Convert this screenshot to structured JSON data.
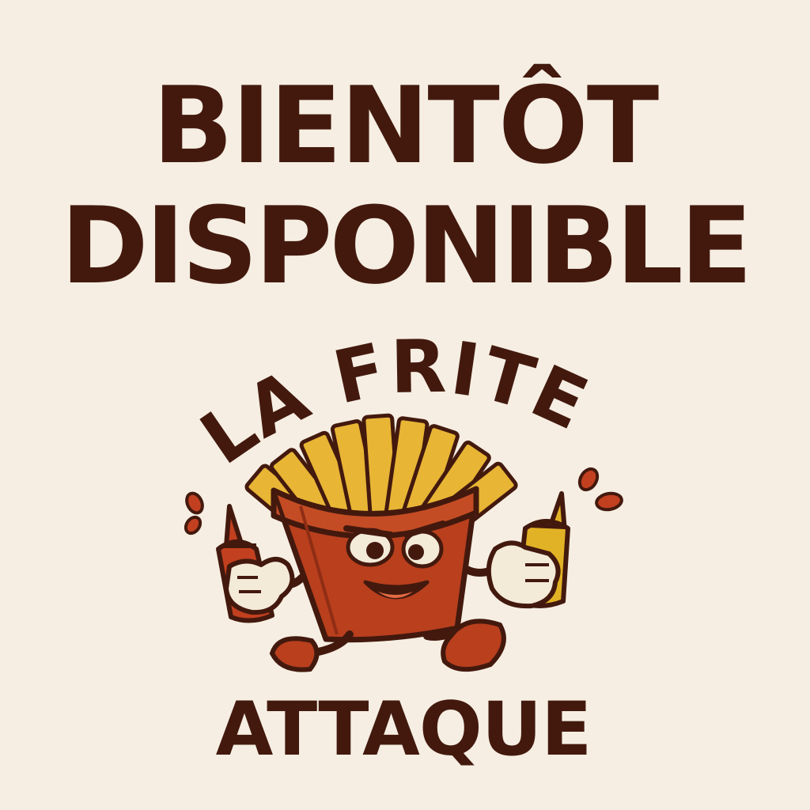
{
  "headline": {
    "line1": "BIENTÔT",
    "line2": "DISPONIBLE"
  },
  "logo": {
    "arc_text": "LA FRITE",
    "bottom_text": "ATTAQUE",
    "mascot": "fries-mascot-with-ketchup-and-mustard"
  },
  "colors": {
    "background": "#f6eee2",
    "text": "#43190e",
    "carton": "#b93f1d",
    "fries": "#e8b535",
    "ketchup": "#c2401f",
    "mustard": "#e2b226",
    "glove": "#f4ead8"
  }
}
